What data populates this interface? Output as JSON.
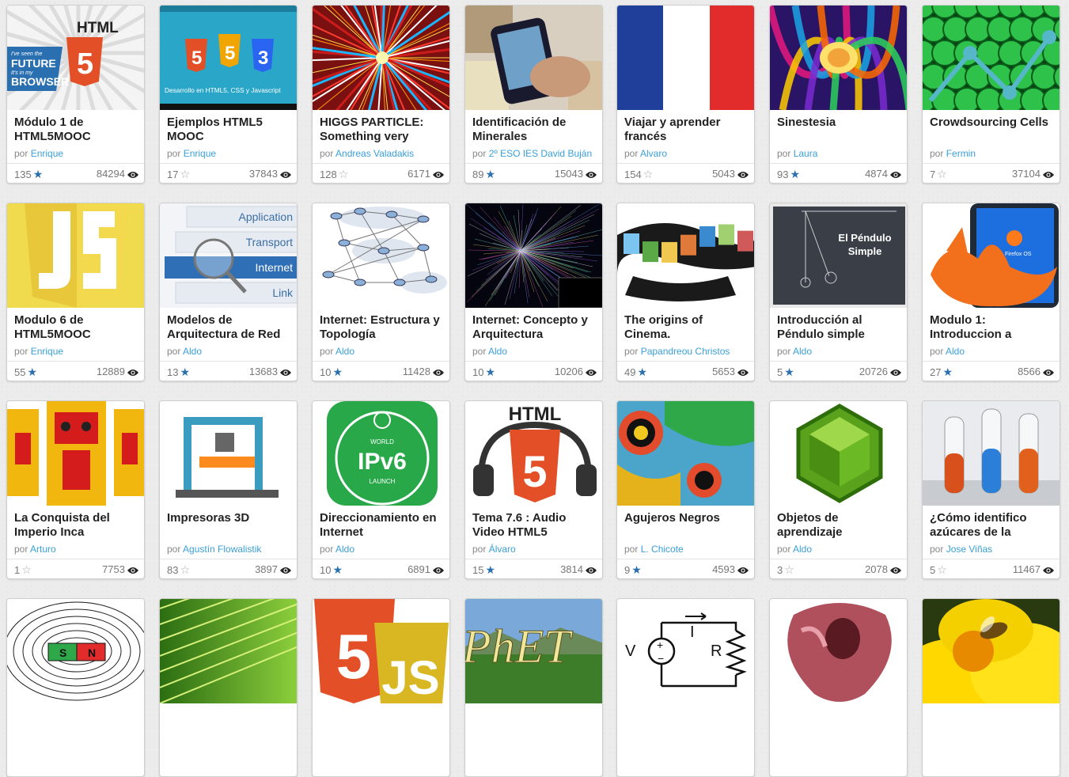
{
  "por_label": "por",
  "cards": [
    {
      "title": "Módulo 1 de HTML5MOOC",
      "author": "Enrique",
      "likes": "135",
      "star": "full",
      "views": "84294",
      "icon": "html5-future-browser-image"
    },
    {
      "title": "Ejemplos HTML5 MOOC",
      "author": "Enrique",
      "likes": "17",
      "star": "empty",
      "views": "37843",
      "icon": "html-css-js-slide-image"
    },
    {
      "title": "HIGGS PARTICLE: Something very",
      "author": "Andreas Valadakis",
      "likes": "128",
      "star": "empty",
      "views": "6171",
      "icon": "particle-collision-image"
    },
    {
      "title": "Identificación de Minerales",
      "author": "2º ESO IES David Buján",
      "likes": "89",
      "star": "full",
      "views": "15043",
      "icon": "phone-qr-scan-image"
    },
    {
      "title": "Viajar y aprender francés",
      "author": "Alvaro",
      "likes": "154",
      "star": "empty",
      "views": "5043",
      "icon": "french-flag-image"
    },
    {
      "title": "Sinestesia",
      "author": "Laura",
      "likes": "93",
      "star": "full",
      "views": "4874",
      "icon": "colorful-brain-image"
    },
    {
      "title": "Crowdsourcing Cells",
      "author": "Fermin",
      "likes": "7",
      "star": "empty",
      "views": "37104",
      "icon": "green-cells-image"
    },
    {
      "title": "Modulo 6 de HTML5MOOC",
      "author": "Enrique",
      "likes": "55",
      "star": "full",
      "views": "12889",
      "icon": "js-shield-image"
    },
    {
      "title": "Modelos de Arquitectura de Red",
      "author": "Aldo",
      "likes": "13",
      "star": "full",
      "views": "13683",
      "icon": "network-layers-image"
    },
    {
      "title": "Internet: Estructura y Topología",
      "author": "Aldo",
      "likes": "10",
      "star": "full",
      "views": "11428",
      "icon": "network-topology-image"
    },
    {
      "title": "Internet: Concepto y Arquitectura",
      "author": "Aldo",
      "likes": "10",
      "star": "full",
      "views": "10206",
      "icon": "internet-map-image"
    },
    {
      "title": "The origins of Cinema.",
      "author": "Papandreou Christos",
      "likes": "49",
      "star": "full",
      "views": "5653",
      "icon": "film-strip-image"
    },
    {
      "title": "Introducción al Péndulo simple",
      "author": "Aldo",
      "likes": "5",
      "star": "full",
      "views": "20726",
      "icon": "pendulum-image"
    },
    {
      "title": "Modulo 1: Introduccion a",
      "author": "Aldo",
      "likes": "27",
      "star": "full",
      "views": "8566",
      "icon": "firefox-os-image"
    },
    {
      "title": "La Conquista del Imperio Inca",
      "author": "Arturo",
      "likes": "1",
      "star": "empty",
      "views": "7753",
      "icon": "inca-figure-image"
    },
    {
      "title": "Impresoras 3D",
      "author": "Agustín Flowalistik",
      "likes": "83",
      "star": "empty",
      "views": "3897",
      "icon": "3d-printer-image"
    },
    {
      "title": "Direccionamiento en Internet",
      "author": "Aldo",
      "likes": "10",
      "star": "full",
      "views": "6891",
      "icon": "ipv6-launch-image"
    },
    {
      "title": "Tema 7.6 : Audio Video HTML5",
      "author": "Álvaro",
      "likes": "15",
      "star": "full",
      "views": "3814",
      "icon": "html5-headphones-image"
    },
    {
      "title": "Agujeros Negros",
      "author": "L. Chicote",
      "likes": "9",
      "star": "full",
      "views": "4593",
      "icon": "aboriginal-art-image"
    },
    {
      "title": "Objetos de aprendizaje",
      "author": "Aldo",
      "likes": "3",
      "star": "empty",
      "views": "2078",
      "icon": "green-cube-image"
    },
    {
      "title": "¿Cómo identifico azúcares de la",
      "author": "Jose Viñas",
      "likes": "5",
      "star": "empty",
      "views": "11467",
      "icon": "test-tubes-image"
    },
    {
      "title": "",
      "author": "",
      "likes": "",
      "star": "",
      "views": "",
      "icon": "magnet-field-image"
    },
    {
      "title": "",
      "author": "",
      "likes": "",
      "star": "",
      "views": "",
      "icon": "green-leaf-image"
    },
    {
      "title": "",
      "author": "",
      "likes": "",
      "star": "",
      "views": "",
      "icon": "html5-js-badges-image"
    },
    {
      "title": "",
      "author": "",
      "likes": "",
      "star": "",
      "views": "",
      "icon": "phet-logo-image",
      "text": "PhET"
    },
    {
      "title": "",
      "author": "",
      "likes": "",
      "star": "",
      "views": "",
      "icon": "circuit-diagram-image",
      "text_v": "V",
      "text_i": "I",
      "text_r": "R"
    },
    {
      "title": "",
      "author": "",
      "likes": "",
      "star": "",
      "views": "",
      "icon": "heart-anatomy-image"
    },
    {
      "title": "",
      "author": "",
      "likes": "",
      "star": "",
      "views": "",
      "icon": "bee-flower-image"
    }
  ],
  "thumb_text": {
    "html": "HTML",
    "five": "5",
    "future_line1": "I've seen the",
    "future_line2": "FUTURE",
    "future_line3": "It's in my",
    "future_line4": "BROWSER",
    "slide_caption": "Desarrollo en HTML5, CSS y Javascript",
    "layer_application": "Application",
    "layer_transport": "Transport",
    "layer_internet": "Internet",
    "layer_link": "Link",
    "pendulum_title1": "El Péndulo",
    "pendulum_title2": "Simple",
    "world": "WORLD",
    "ipv6": "IPv6",
    "launch": "LAUNCH",
    "magnet_s": "S",
    "magnet_n": "N",
    "firefox_os": "Firefox OS"
  },
  "colors": {
    "link": "#3aa0d8",
    "star_full": "#2a6fb0",
    "html5_orange": "#e34f26",
    "js_yellow": "#f0db4f",
    "css_blue": "#2965f1"
  }
}
